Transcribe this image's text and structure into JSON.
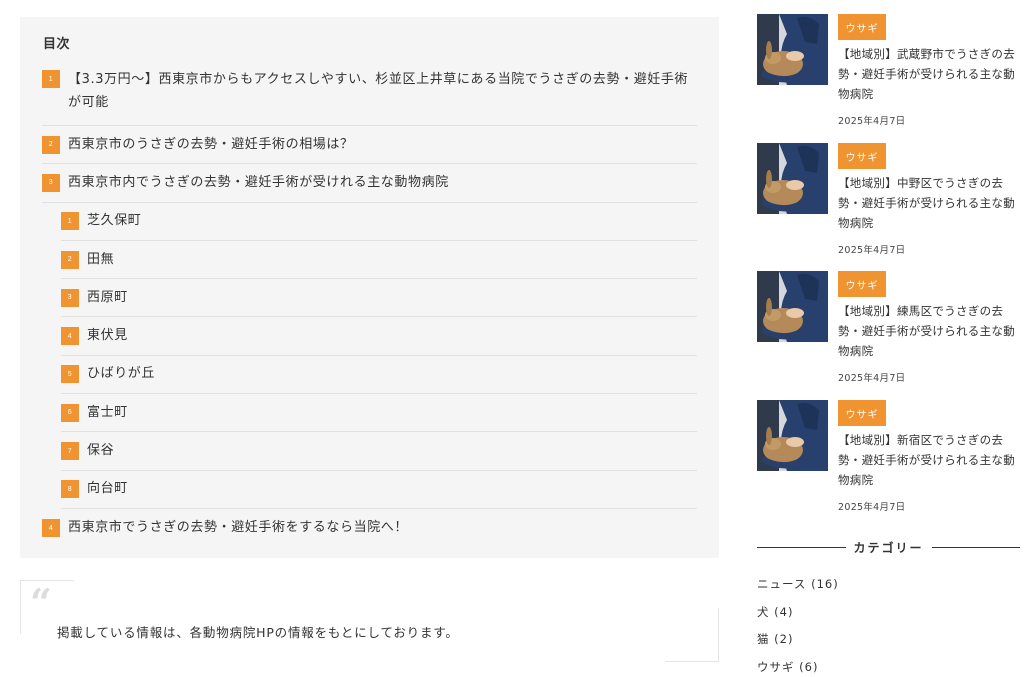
{
  "toc": {
    "title": "目次",
    "items": [
      {
        "num": "1",
        "text": "【3.3万円〜】西東京市からもアクセスしやすい、杉並区上井草にある当院でうさぎの去勢・避妊手術が可能"
      },
      {
        "num": "2",
        "text": "西東京市のうさぎの去勢・避妊手術の相場は？"
      },
      {
        "num": "3",
        "text": "西東京市内でうさぎの去勢・避妊手術が受けれる主な動物病院"
      },
      {
        "num": "1",
        "text": "芝久保町"
      },
      {
        "num": "2",
        "text": "田無"
      },
      {
        "num": "3",
        "text": "西原町"
      },
      {
        "num": "4",
        "text": "東伏見"
      },
      {
        "num": "5",
        "text": "ひばりが丘"
      },
      {
        "num": "6",
        "text": "富士町"
      },
      {
        "num": "7",
        "text": "保谷"
      },
      {
        "num": "8",
        "text": "向台町"
      },
      {
        "num": "4",
        "text": "西東京市でうさぎの去勢・避妊手術をするなら当院へ！"
      }
    ]
  },
  "quote": {
    "mark": "“",
    "text": "掲載している情報は、各動物病院HPの情報をもとにしております。"
  },
  "posts": [
    {
      "tag": "ウサギ",
      "title": "【地域別】武蔵野市でうさぎの去勢・避妊手術が受けられる主な動物病院",
      "date": "2025年4月7日"
    },
    {
      "tag": "ウサギ",
      "title": "【地域別】中野区でうさぎの去勢・避妊手術が受けられる主な動物病院",
      "date": "2025年4月7日"
    },
    {
      "tag": "ウサギ",
      "title": "【地域別】練馬区でうさぎの去勢・避妊手術が受けられる主な動物病院",
      "date": "2025年4月7日"
    },
    {
      "tag": "ウサギ",
      "title": "【地域別】新宿区でうさぎの去勢・避妊手術が受けられる主な動物病院",
      "date": "2025年4月7日"
    }
  ],
  "category": {
    "title": "カテゴリー",
    "items": [
      {
        "label": "ニュース (16)"
      },
      {
        "label": "犬 (4)"
      },
      {
        "label": "猫 (2)"
      },
      {
        "label": "ウサギ (6)"
      }
    ]
  },
  "colors": {
    "accent": "#f09432",
    "toc_bg": "#f5f5f5",
    "text": "#333333"
  },
  "icons": {
    "quote": "quote-open-icon",
    "thumbnail": "rabbit-photo"
  }
}
